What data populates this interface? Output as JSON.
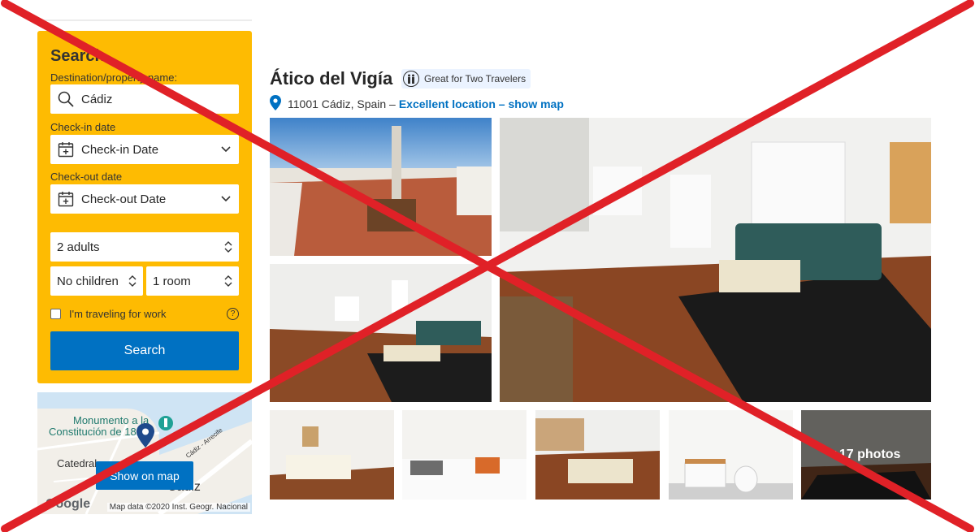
{
  "sidebar": {
    "search_title": "Search",
    "destination_label": "Destination/property name:",
    "destination_value": "Cádiz",
    "checkin_label": "Check-in date",
    "checkin_value": "Check-in Date",
    "checkout_label": "Check-out date",
    "checkout_value": "Check-out Date",
    "adults": "2 adults",
    "children": "No children",
    "rooms": "1 room",
    "work_label": "I'm traveling for work",
    "help": "?",
    "search_button": "Search"
  },
  "map": {
    "label_monument": "Monumento a la",
    "label_monument2": "Constitución de 1812",
    "label_cathedral": "Catedral",
    "label_city": "Cádiz",
    "label_road": "Cádiz - Arrecife",
    "button": "Show on map",
    "google": "Google",
    "attribution": "Map data ©2020 Inst. Geogr. Nacional"
  },
  "property": {
    "name": "Ático del Vigía",
    "badge": "Great for Two Travelers",
    "address": "11001 Cádiz, Spain –",
    "location_link": "Excellent location – show map"
  },
  "gallery": {
    "more_photos": "+17 photos"
  },
  "colors": {
    "brand_blue": "#0071c2",
    "search_yellow": "#febb02",
    "overlay_red": "#e02127"
  }
}
